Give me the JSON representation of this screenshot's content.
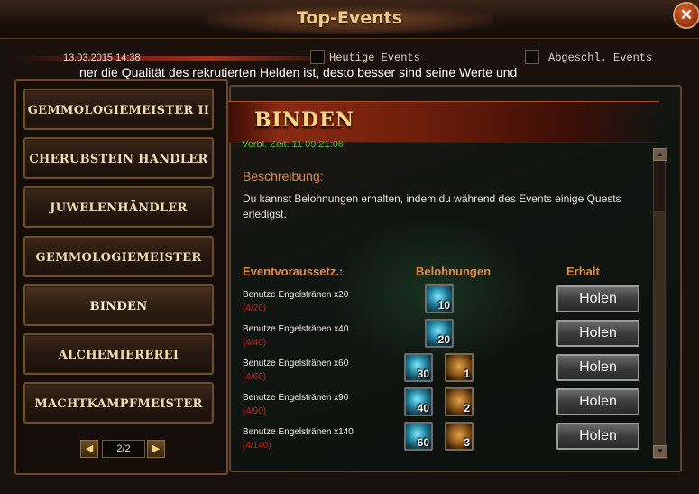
{
  "window": {
    "title": "Top-Events",
    "close_label": "✕"
  },
  "header": {
    "timestamp": "13.03.2015 14:38",
    "filter_heutige": "Heutige Events",
    "filter_abgeschl": "Abgeschl. Events",
    "ticker": "ner die Qualität des rekrutierten Helden ist, desto besser sind seine Werte und"
  },
  "sidebar": {
    "items": [
      {
        "label": "GEMMOLOGIEMEISTER II"
      },
      {
        "label": "CHERUBSTEIN HANDLER"
      },
      {
        "label": "JUWELENHÄNDLER"
      },
      {
        "label": "GEMMOLOGIEMEISTER"
      },
      {
        "label": "BINDEN"
      },
      {
        "label": "ALCHEMIEREREI"
      },
      {
        "label": "MACHTKAMPFMEISTER"
      }
    ],
    "active_index": 4,
    "pager": {
      "text": "2/2",
      "prev": "◀",
      "next": "▶"
    }
  },
  "event": {
    "title": "BINDEN",
    "end_time": "Verbl. Zeit: 11 09:21:06",
    "description_label": "Beschreibung:",
    "description": "Du kannst Belohnungen erhalten, indem du während des Events einige Quests erledigst.",
    "columns": {
      "requirement": "Eventvoraussetz.:",
      "rewards": "Belohnungen",
      "claim": "Erhalt"
    },
    "rows": [
      {
        "name": "Benutze Engelstränen x20",
        "progress": "(4/20)",
        "rewards": [
          {
            "icon": "angel-tear-icon",
            "count": "10"
          }
        ],
        "button": "Holen"
      },
      {
        "name": "Benutze Engelstränen x40",
        "progress": "(4/40)",
        "rewards": [
          {
            "icon": "angel-tear-icon",
            "count": "20"
          }
        ],
        "button": "Holen"
      },
      {
        "name": "Benutze Engelstränen x60",
        "progress": "(4/60)",
        "rewards": [
          {
            "icon": "angel-tear-icon",
            "count": "30"
          },
          {
            "icon": "scroll-icon",
            "count": "1"
          }
        ],
        "button": "Holen"
      },
      {
        "name": "Benutze Engelstränen x90",
        "progress": "(4/90)",
        "rewards": [
          {
            "icon": "angel-tear-icon",
            "count": "40"
          },
          {
            "icon": "scroll-icon",
            "count": "2"
          }
        ],
        "button": "Holen"
      },
      {
        "name": "Benutze Engelstränen x140",
        "progress": "(4/140)",
        "rewards": [
          {
            "icon": "angel-tear-icon",
            "count": "60"
          },
          {
            "icon": "scroll-icon",
            "count": "3"
          }
        ],
        "button": "Holen"
      }
    ]
  },
  "colors": {
    "accent": "#e28c4c",
    "title_gold": "#f0c986",
    "progress_red": "#c12818",
    "timer_green": "#58c23a"
  }
}
